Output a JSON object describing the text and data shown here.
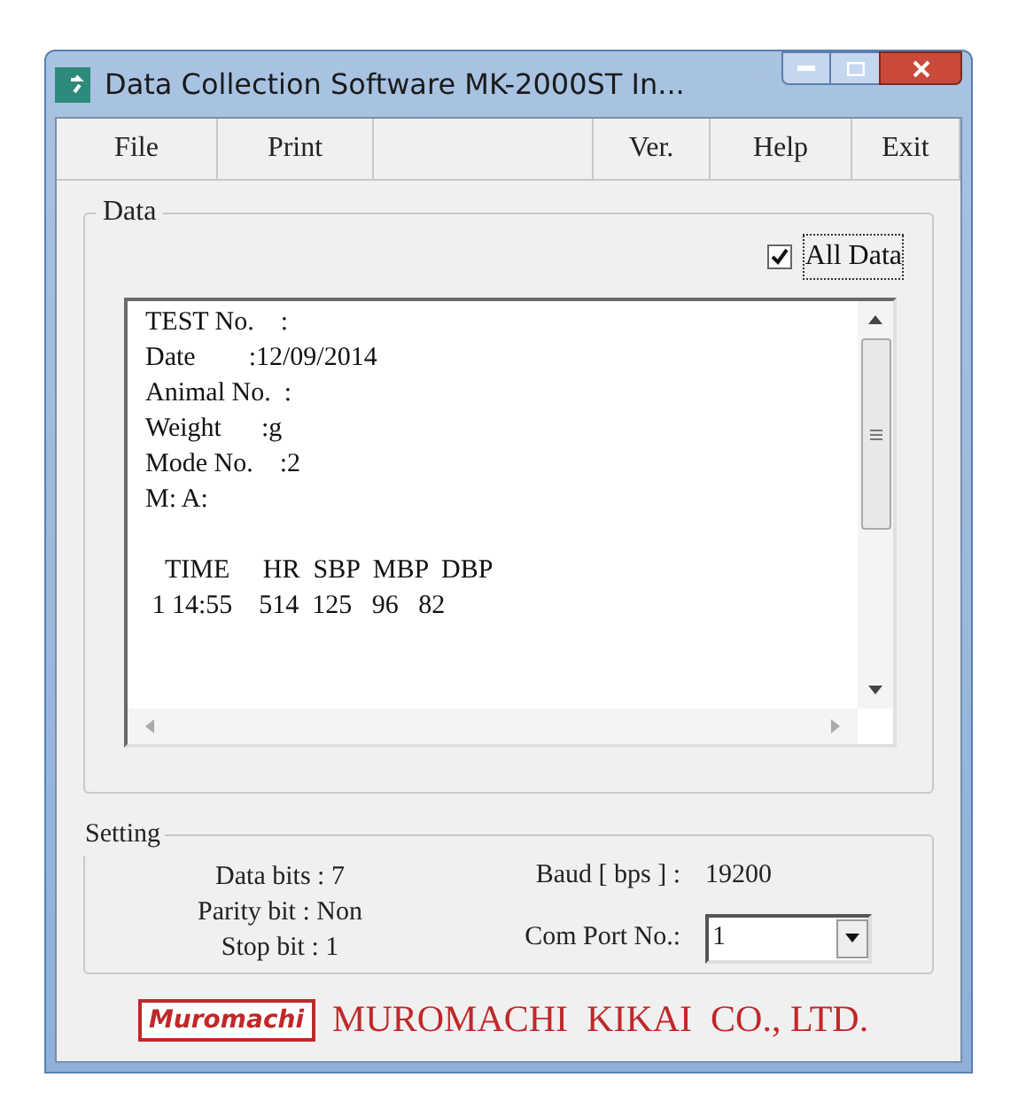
{
  "window": {
    "title": "Data Collection Software MK-2000ST In..."
  },
  "menu": [
    {
      "kind": "button",
      "label": "File"
    },
    {
      "kind": "button",
      "label": "Print"
    },
    {
      "kind": "spacer"
    },
    {
      "kind": "button",
      "label": "Ver."
    },
    {
      "kind": "button",
      "label": "Help"
    },
    {
      "kind": "button",
      "label": "Exit"
    }
  ],
  "data_group": {
    "title": "Data",
    "all_data": {
      "label": "All Data",
      "checked": true
    },
    "header_lines": [
      "TEST No.    :",
      "Date        :12/09/2014",
      "Animal No.  :",
      "Weight      :g",
      "Mode No.    :2",
      "M: A:"
    ],
    "table_lines": [
      "   TIME     HR  SBP  MBP  DBP",
      " 1 14:55    514  125   96   82"
    ]
  },
  "setting_group": {
    "title": "Setting",
    "data_bits": "Data bits : 7",
    "parity_bit": "Parity bit : Non",
    "stop_bit": "Stop bit : 1",
    "baud_label": "Baud [ bps ] :",
    "baud_value": "19200",
    "com_port_label": "Com Port No.:",
    "com_port_value": "1"
  },
  "footer": {
    "logo": "Muromachi",
    "company": "MUROMACHI  KIKAI  CO., LTD."
  }
}
